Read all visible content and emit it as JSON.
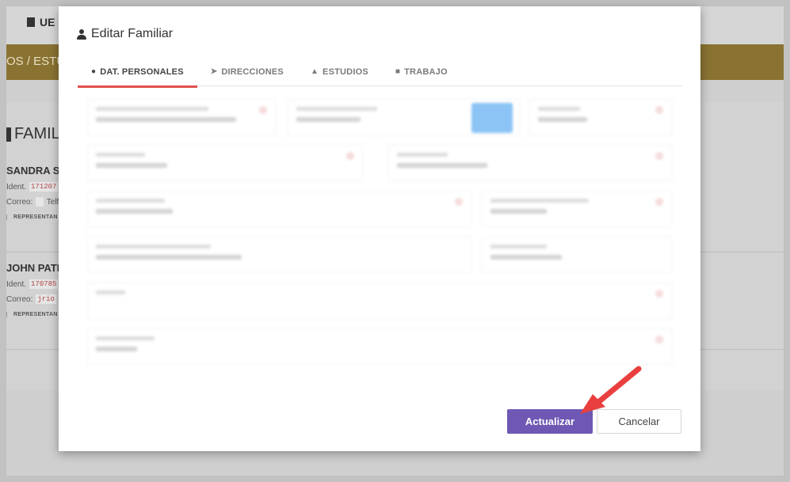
{
  "background": {
    "logo_text": "UE",
    "banner_text": "OS / ESTU",
    "section_title": "FAMILI",
    "persons": [
      {
        "name": "SANDRA SU",
        "ident_label": "Ident.",
        "ident_value": "171207",
        "correo_label": "Correo:",
        "telf_label": "Telf:",
        "tag": "REPRESENTAN"
      },
      {
        "name": "JOHN PATR",
        "ident_label": "Ident.",
        "ident_value": "170785",
        "correo_label": "Correo:",
        "correo_value": "jrio",
        "tag": "REPRESENTAN"
      }
    ]
  },
  "modal": {
    "title": "Editar Familiar",
    "tabs": [
      {
        "label": "DAT. PERSONALES",
        "icon": "person-icon",
        "active": true
      },
      {
        "label": "DIRECCIONES",
        "icon": "location-arrow-icon",
        "active": false
      },
      {
        "label": "ESTUDIOS",
        "icon": "graduation-cap-icon",
        "active": false
      },
      {
        "label": "TRABAJO",
        "icon": "briefcase-icon",
        "active": false
      }
    ],
    "buttons": {
      "primary_label": "Actualizar",
      "cancel_label": "Cancelar"
    }
  },
  "colors": {
    "accent": "#6f58b3",
    "tab_underline": "#e0524f",
    "banner": "#8a7332",
    "annotation_arrow": "#ea3f3f"
  }
}
